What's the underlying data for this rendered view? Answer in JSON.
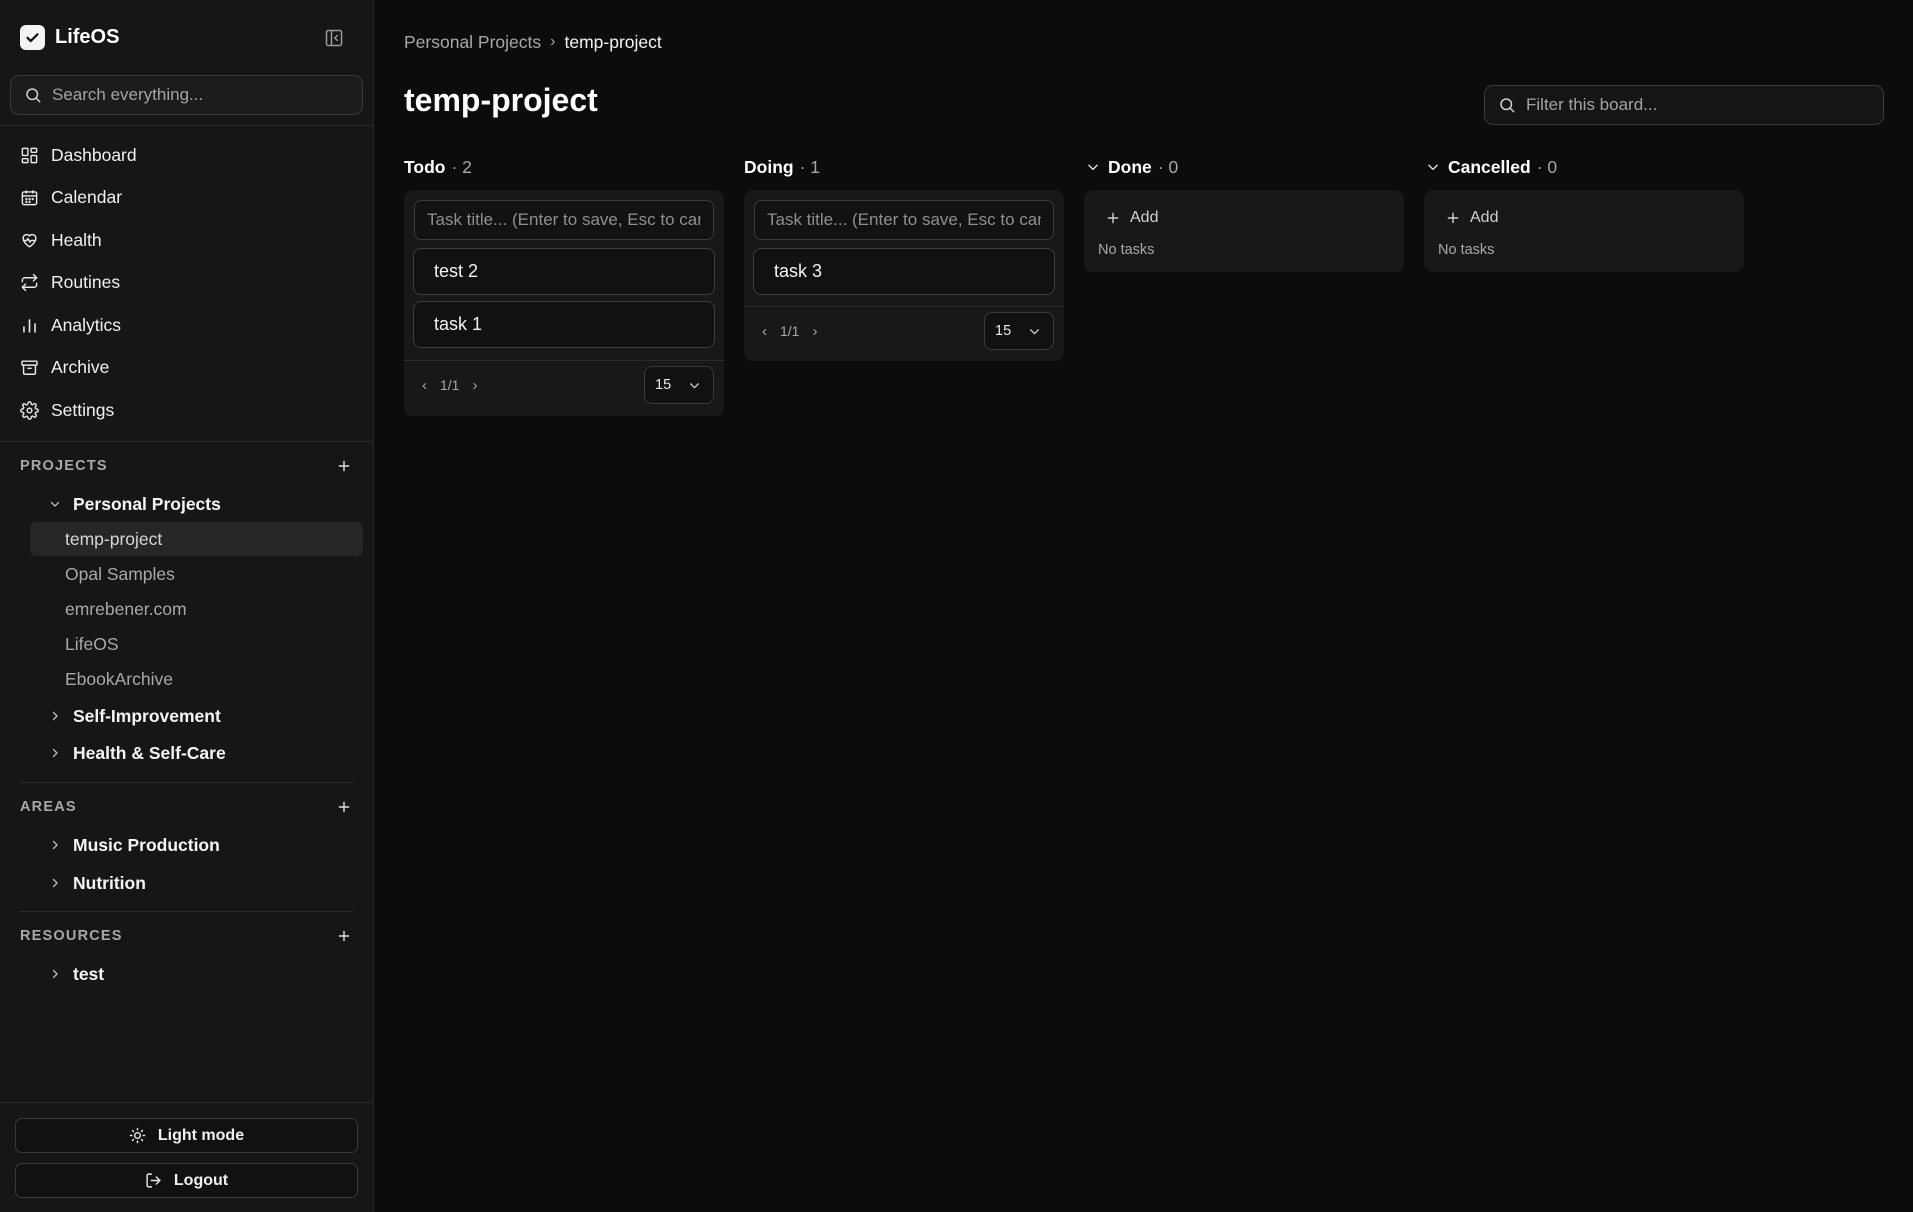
{
  "app": {
    "name": "LifeOS"
  },
  "search": {
    "placeholder": "Search everything..."
  },
  "nav": [
    {
      "label": "Dashboard",
      "icon": "dashboard-icon"
    },
    {
      "label": "Calendar",
      "icon": "calendar-icon"
    },
    {
      "label": "Health",
      "icon": "heart-pulse-icon"
    },
    {
      "label": "Routines",
      "icon": "repeat-icon"
    },
    {
      "label": "Analytics",
      "icon": "bar-chart-icon"
    },
    {
      "label": "Archive",
      "icon": "archive-icon"
    },
    {
      "label": "Settings",
      "icon": "gear-icon"
    }
  ],
  "projects": {
    "title": "PROJECTS",
    "groups": [
      {
        "label": "Personal Projects",
        "expanded": true,
        "items": [
          "temp-project",
          "Opal Samples",
          "emrebener.com",
          "LifeOS",
          "EbookArchive"
        ]
      },
      {
        "label": "Self-Improvement",
        "expanded": false
      },
      {
        "label": "Health & Self-Care",
        "expanded": false
      }
    ]
  },
  "areas": {
    "title": "AREAS",
    "groups": [
      {
        "label": "Music Production"
      },
      {
        "label": "Nutrition"
      }
    ]
  },
  "resources": {
    "title": "RESOURCES",
    "groups": [
      {
        "label": "test"
      }
    ]
  },
  "footer": {
    "theme_label": "Light mode",
    "logout_label": "Logout"
  },
  "breadcrumb": {
    "parent": "Personal Projects",
    "separator": "›",
    "current": "temp-project"
  },
  "page": {
    "title": "temp-project"
  },
  "filter": {
    "placeholder": "Filter this board..."
  },
  "board": {
    "columns": [
      {
        "name": "Todo",
        "count": "· 2",
        "input_placeholder": "Task title... (Enter to save, Esc to cancel)",
        "tasks": [
          "test 2",
          "task 1"
        ],
        "page": "1/1",
        "page_size": "15"
      },
      {
        "name": "Doing",
        "count": "· 1",
        "input_placeholder": "Task title... (Enter to save, Esc to cancel)",
        "tasks": [
          "task 3"
        ],
        "page": "1/1",
        "page_size": "15"
      },
      {
        "name": "Done",
        "count": "· 0",
        "add_label": "Add",
        "empty_text": "No tasks"
      },
      {
        "name": "Cancelled",
        "count": "· 0",
        "add_label": "Add",
        "empty_text": "No tasks"
      }
    ],
    "pager_prev": "‹",
    "pager_next": "›"
  },
  "colors": {
    "background": "#0c0c0c",
    "sidebar": "#161616",
    "column": "#181818",
    "border": "#3a3a3a"
  }
}
